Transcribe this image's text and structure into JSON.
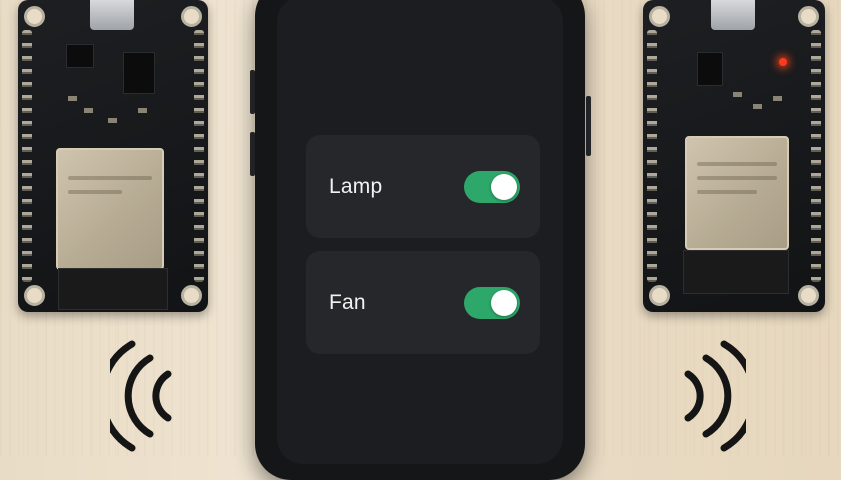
{
  "app": {
    "controls": [
      {
        "label": "Lamp",
        "state": "on"
      },
      {
        "label": "Fan",
        "state": "on"
      }
    ]
  },
  "colors": {
    "toggle_on": "#2ea86a",
    "card_bg": "#26272b",
    "screen_bg": "#1c1d20",
    "status_led": "#ff3a1c"
  },
  "icons": {
    "left_signal": "wireless-signal-icon",
    "right_signal": "wireless-signal-icon"
  }
}
